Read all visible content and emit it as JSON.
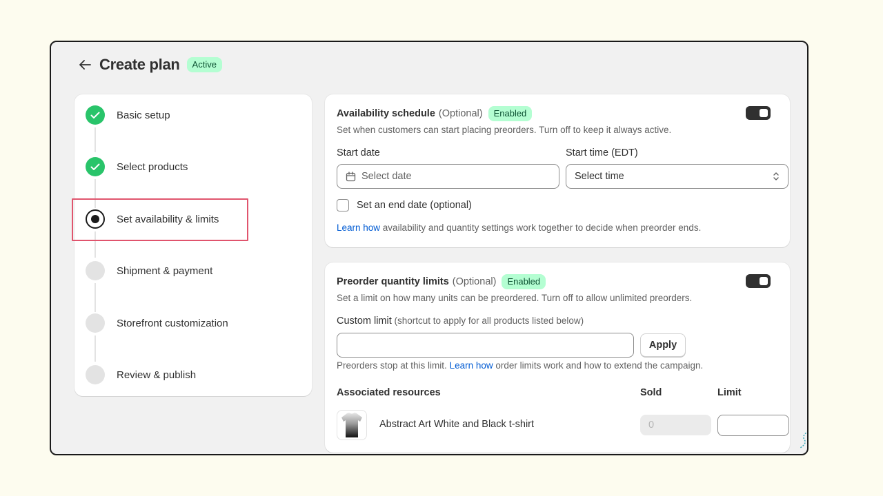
{
  "header": {
    "title": "Create plan",
    "status_badge": "Active"
  },
  "steps": [
    {
      "label": "Basic setup",
      "state": "done"
    },
    {
      "label": "Select products",
      "state": "done"
    },
    {
      "label": "Set availability & limits",
      "state": "current"
    },
    {
      "label": "Shipment & payment",
      "state": "pending"
    },
    {
      "label": "Storefront customization",
      "state": "pending"
    },
    {
      "label": "Review & publish",
      "state": "pending"
    }
  ],
  "availability": {
    "title": "Availability schedule",
    "optional": "(Optional)",
    "badge": "Enabled",
    "toggle_on": true,
    "description": "Set when customers can start placing preorders. Turn off to keep it always active.",
    "start_date_label": "Start date",
    "start_date_placeholder": "Select date",
    "start_time_label": "Start time (EDT)",
    "start_time_value": "Select time",
    "end_date_checkbox": "Set an end date (optional)",
    "end_date_checked": false,
    "learn_link": "Learn how",
    "learn_text": " availability and quantity settings work together to decide when preorder ends."
  },
  "quantity": {
    "title": "Preorder quantity limits",
    "optional": "(Optional)",
    "badge": "Enabled",
    "toggle_on": true,
    "description": "Set a limit on how many units can be preordered. Turn off to allow unlimited preorders.",
    "custom_limit_label": "Custom limit",
    "custom_limit_hint": " (shortcut to apply for all products listed below)",
    "custom_limit_value": "",
    "apply_label": "Apply",
    "help_prefix": "Preorders stop at this limit. ",
    "help_link": "Learn how",
    "help_suffix": " order limits work and how to extend the campaign.",
    "columns": {
      "resources": "Associated resources",
      "sold": "Sold",
      "limit": "Limit"
    },
    "rows": [
      {
        "product": "Abstract Art White and Black t-shirt",
        "sold": "0",
        "limit": ""
      }
    ]
  },
  "colors": {
    "accent_green": "#29c46a",
    "badge_bg": "#b4fed2",
    "link_blue": "#005bd3",
    "highlight_red": "#e0546d",
    "page_bg": "#fdfcef"
  }
}
